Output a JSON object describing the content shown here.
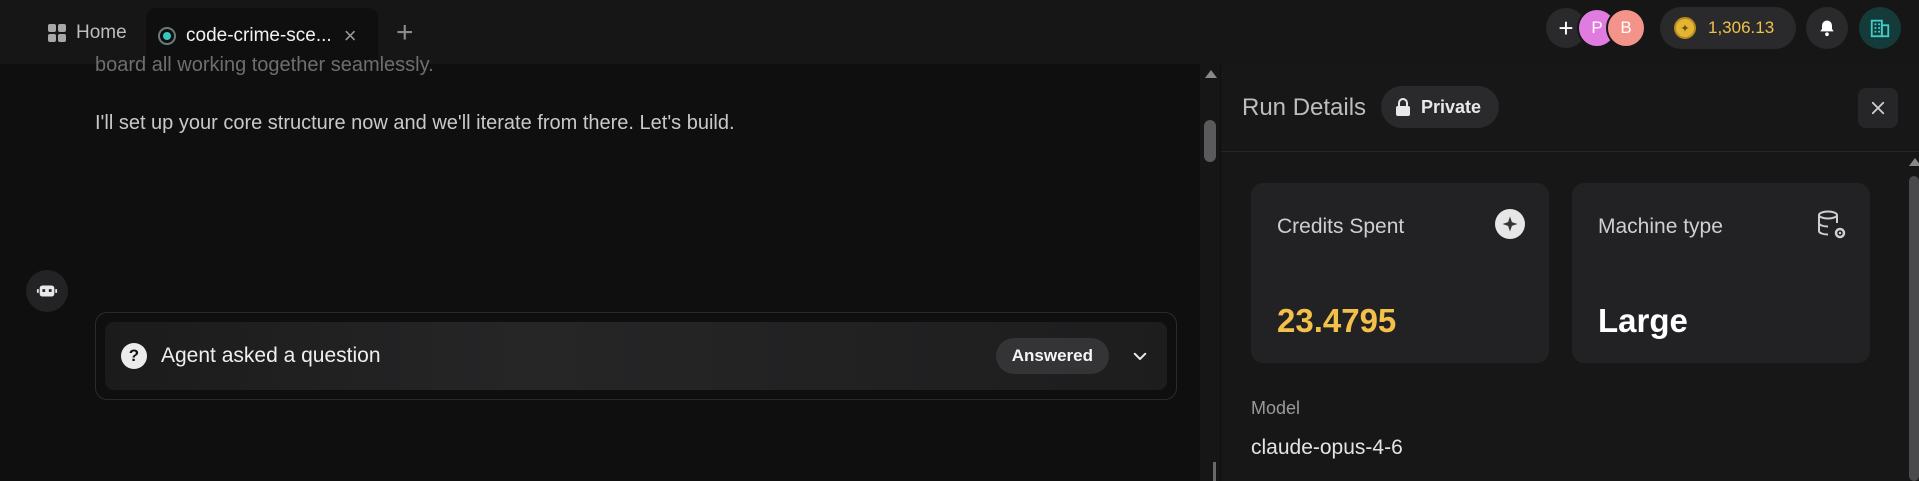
{
  "tabs": {
    "home_label": "Home",
    "active_label": "code-crime-sce...",
    "close_glyph": "×",
    "add_glyph": "+"
  },
  "header": {
    "new_glyph": "+",
    "avatars": [
      "P",
      "B"
    ],
    "credits_balance": "1,306.13",
    "accent_color": "#f0c24a"
  },
  "chat": {
    "faded_text": "board all working together seamlessly.",
    "message_text": "I'll set up your core structure now and we'll iterate from there. Let's build.",
    "question_card": {
      "title": "Agent asked a question",
      "status": "Answered"
    }
  },
  "run_details": {
    "title": "Run Details",
    "visibility": "Private",
    "credits_spent_label": "Credits Spent",
    "credits_spent_value": "23.4795",
    "machine_type_label": "Machine type",
    "machine_type_value": "Large",
    "model_label": "Model",
    "model_value": "claude-opus-4-6"
  }
}
